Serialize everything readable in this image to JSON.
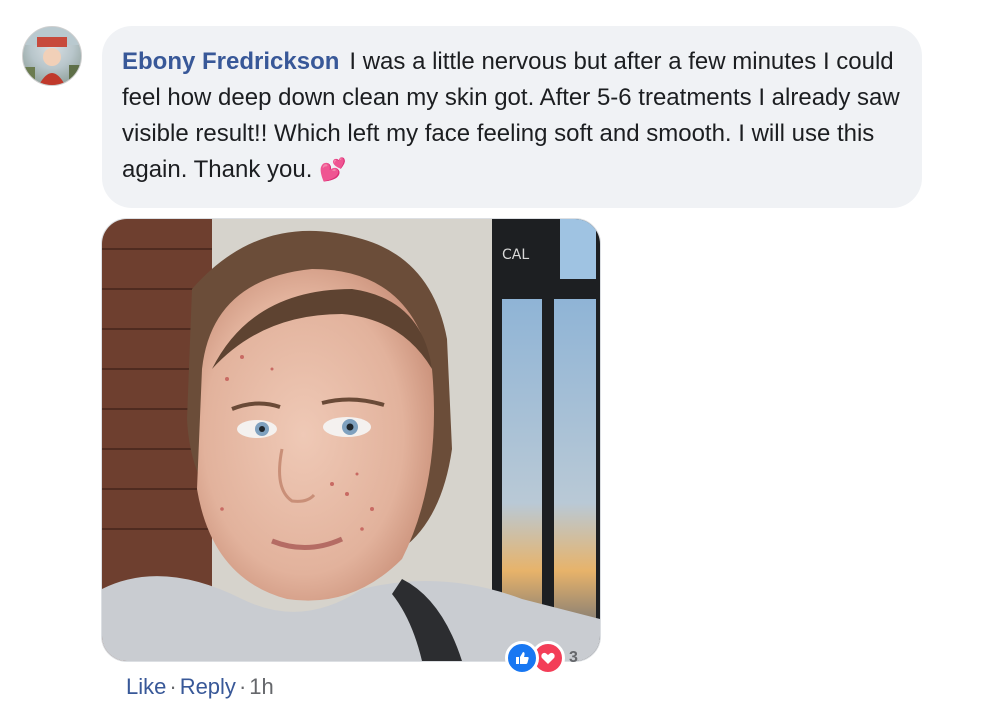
{
  "comment": {
    "author": "Ebony Fredrickson",
    "text": "I was a little nervous but after a few minutes I could feel how deep down clean my skin got. After 5-6 treatments I already saw visible result!! Which left my face feeling soft and smooth. I will use this again. Thank you.",
    "emoji": "💕"
  },
  "photo": {
    "sign_text": "CAL"
  },
  "reactions": {
    "icons": [
      "like-icon",
      "love-icon"
    ],
    "count": "3",
    "colors": {
      "like": "#1877f2",
      "love": "#f33e58"
    }
  },
  "actions": {
    "like_label": "Like",
    "reply_label": "Reply",
    "separator": "·",
    "timestamp": "1h"
  },
  "colors": {
    "link": "#385898",
    "bubble_bg": "#f0f2f5",
    "muted": "#65676b"
  }
}
